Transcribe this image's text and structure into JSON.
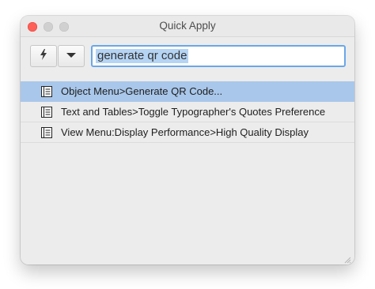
{
  "window": {
    "title": "Quick Apply",
    "traffic_lights": [
      "close",
      "minimize",
      "maximize"
    ]
  },
  "toolbar": {
    "lightning_icon": "lightning-icon",
    "dropdown_icon": "triangle-down-icon",
    "search_value": "generate qr code"
  },
  "results": [
    {
      "label": "Object Menu>Generate QR Code...",
      "icon": "menu-item-icon",
      "selected": true
    },
    {
      "label": "Text and Tables>Toggle Typographer's Quotes Preference",
      "icon": "menu-item-icon",
      "selected": false
    },
    {
      "label": "View Menu:Display Performance>High Quality Display",
      "icon": "menu-item-icon",
      "selected": false
    }
  ],
  "colors": {
    "selection": "#a9c7ea",
    "search_focus": "#6aa7e8",
    "text_highlight": "#b5d4f4",
    "close_light": "#fe5f57"
  }
}
